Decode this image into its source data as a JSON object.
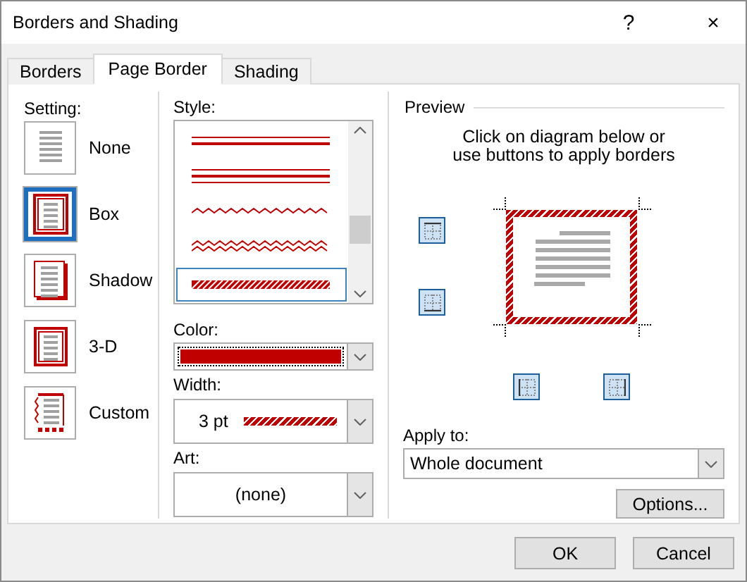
{
  "window": {
    "title": "Borders and Shading",
    "help": "?",
    "close": "×"
  },
  "tabs": [
    {
      "label": "Borders",
      "selected": false
    },
    {
      "label": "Page Border",
      "selected": true
    },
    {
      "label": "Shading",
      "selected": false
    }
  ],
  "setting": {
    "label": "Setting:",
    "options": [
      {
        "kind": "none",
        "label": "None",
        "selected": false
      },
      {
        "kind": "box",
        "label": "Box",
        "selected": true
      },
      {
        "kind": "shadow",
        "label": "Shadow",
        "selected": false
      },
      {
        "kind": "threed",
        "label": "3-D",
        "selected": false
      },
      {
        "kind": "custom",
        "label": "Custom",
        "selected": false
      }
    ]
  },
  "style": {
    "label": "Style:",
    "items": [
      {
        "kind": "double",
        "selected": false
      },
      {
        "kind": "triple",
        "selected": false
      },
      {
        "kind": "wave",
        "selected": false
      },
      {
        "kind": "double-wave",
        "selected": false
      },
      {
        "kind": "hatched",
        "selected": true
      }
    ]
  },
  "color": {
    "label": "Color:",
    "color": "#c00000"
  },
  "width": {
    "label": "Width:",
    "value": "3 pt"
  },
  "art": {
    "label": "Art:",
    "value": "(none)"
  },
  "preview": {
    "label": "Preview",
    "instruction": "Click on diagram below or\nuse buttons to apply borders",
    "border_buttons": [
      {
        "kind": "top",
        "on": true
      },
      {
        "kind": "bottom",
        "on": true
      },
      {
        "kind": "left",
        "on": true
      },
      {
        "kind": "right",
        "on": true
      }
    ]
  },
  "apply_to": {
    "label": "Apply to:",
    "value": "Whole document"
  },
  "options_button": "Options...",
  "buttons": [
    "OK",
    "Cancel"
  ]
}
